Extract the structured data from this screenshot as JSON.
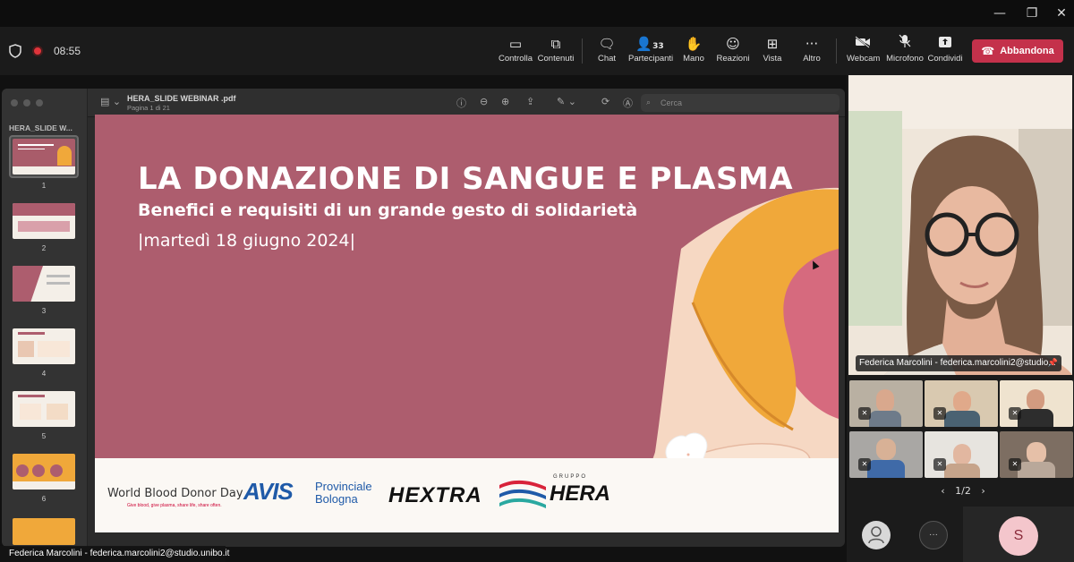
{
  "window": {
    "min": "—",
    "restore": "❐",
    "close": "✕"
  },
  "meeting": {
    "timer": "08:55",
    "toolbar": [
      {
        "key": "controlla",
        "label": "Controlla",
        "icon": "present-screen-icon"
      },
      {
        "key": "contenuti",
        "label": "Contenuti",
        "icon": "share-content-icon"
      },
      {
        "key": "chat",
        "label": "Chat",
        "icon": "chat-icon"
      },
      {
        "key": "partecipanti",
        "label": "Partecipanti",
        "icon": "people-icon",
        "count": "33"
      },
      {
        "key": "mano",
        "label": "Mano",
        "icon": "raise-hand-icon"
      },
      {
        "key": "reazioni",
        "label": "Reazioni",
        "icon": "reactions-icon"
      },
      {
        "key": "vista",
        "label": "Vista",
        "icon": "grid-view-icon"
      },
      {
        "key": "altro",
        "label": "Altro",
        "icon": "more-icon"
      },
      {
        "key": "webcam",
        "label": "Webcam",
        "icon": "camera-off-icon"
      },
      {
        "key": "microfono",
        "label": "Microfono",
        "icon": "mic-off-icon"
      },
      {
        "key": "condividi",
        "label": "Condividi",
        "icon": "share-icon"
      }
    ],
    "leave_label": "Abbandona"
  },
  "preview": {
    "file_title": "HERA_SLIDE WEBINAR .pdf",
    "page_info": "Pagina 1 di 21",
    "sidebar_title": "HERA_SLIDE W...",
    "search_placeholder": "Cerca",
    "thumbnails": [
      "1",
      "2",
      "3",
      "4",
      "5",
      "6"
    ]
  },
  "slide": {
    "title": "LA DONAZIONE DI SANGUE E PLASMA",
    "subtitle": "Benefici e requisiti di un grande gesto di solidarietà",
    "date": "|martedì 18 giugno 2024|",
    "logos": {
      "wbdd": "World Blood Donor Day",
      "wbdd_tag": "Give blood, give plasma, share life, share often.",
      "avis": "AVIS",
      "avis_sub1": "Provinciale",
      "avis_sub2": "Bologna",
      "hextra": "HEXTRA",
      "hera_group": "GRUPPO",
      "hera": "HERA"
    },
    "colors": {
      "background": "#ad5d6e",
      "sleeve": "#f0a83a",
      "skin": "#f6d8c3"
    }
  },
  "participants": {
    "main_name": "Federica Marcolini - federica.marcolini2@studio...",
    "pager": "1/2",
    "pager_prev": "‹",
    "pager_next": "›",
    "self_initial": "S",
    "more_label": "···"
  },
  "bottom": {
    "name": "Federica Marcolini - federica.marcolini2@studio.unibo.it"
  }
}
